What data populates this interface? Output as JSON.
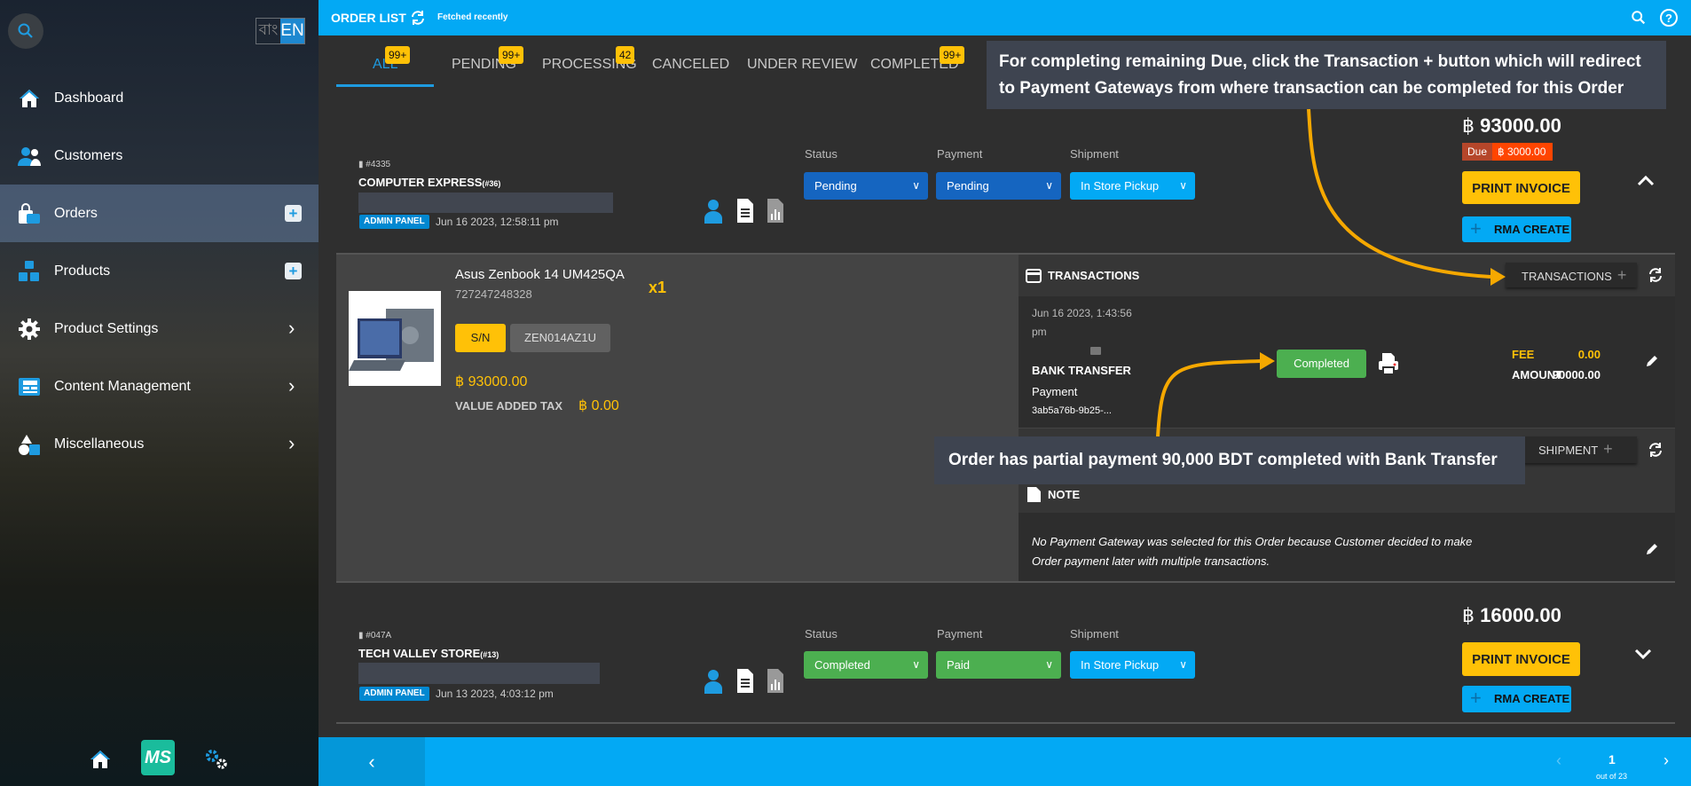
{
  "sidebar": {
    "lang": {
      "bn": "বাং",
      "en": "EN"
    },
    "items": [
      {
        "label": "Dashboard",
        "icon": "home-icon"
      },
      {
        "label": "Customers",
        "icon": "users-icon"
      },
      {
        "label": "Orders",
        "icon": "shopping-bag-icon",
        "active": true,
        "action": "plus"
      },
      {
        "label": "Products",
        "icon": "boxes-icon",
        "action": "plus"
      },
      {
        "label": "Product Settings",
        "icon": "gear-icon",
        "action": "chevron"
      },
      {
        "label": "Content Management",
        "icon": "newspaper-icon",
        "action": "chevron"
      },
      {
        "label": "Miscellaneous",
        "icon": "shapes-icon",
        "action": "chevron"
      }
    ],
    "footer": {
      "logo": "MS"
    }
  },
  "topbar": {
    "title": "ORDER LIST",
    "status": "Fetched recently"
  },
  "tabs": [
    {
      "label": "ALL",
      "badge": "99+",
      "active": true
    },
    {
      "label": "PENDING",
      "badge": "99+"
    },
    {
      "label": "PROCESSING",
      "badge": "42"
    },
    {
      "label": "CANCELED"
    },
    {
      "label": "UNDER REVIEW"
    },
    {
      "label": "COMPLETED",
      "badge": "99+"
    }
  ],
  "callouts": {
    "top": [
      "For completing remaining Due, click the Transaction + button which will redirect",
      "to Payment Gateways from where transaction can be completed for this Order"
    ],
    "middle": "Order has partial payment 90,000 BDT completed with Bank Transfer",
    "color": "#f5a800"
  },
  "labels": {
    "status": "Status",
    "payment": "Payment",
    "shipment": "Shipment",
    "print_invoice": "PRINT INVOICE",
    "rma_create": "RMA CREATE",
    "admin_panel": "ADMIN PANEL",
    "due": "Due",
    "currency_icon": "taka-sign"
  },
  "orders": [
    {
      "id": "#4335",
      "customer": "COMPUTER EXPRESS",
      "customer_no": "(#36)",
      "date": "Jun 16 2023, 12:58:11 pm",
      "status": "Pending",
      "payment": "Pending",
      "shipment": "In Store Pickup",
      "total": "93000.00",
      "due": "3000.00",
      "expanded": true,
      "item": {
        "name": "Asus Zenbook 14 UM425QA",
        "sku": "727247248328",
        "qty": "x1",
        "sn_label": "S/N",
        "serial": "ZEN014AZ1U",
        "price": "93000.00",
        "vat_label": "VALUE ADDED TAX",
        "vat": "0.00"
      },
      "transactions": {
        "title": "TRANSACTIONS",
        "button": "TRANSACTIONS",
        "entries": [
          {
            "date": "Jun 16 2023, 1:43:56",
            "date2": "pm",
            "method": "BANK TRANSFER",
            "type": "Payment",
            "ref": "3ab5a76b-9b25-...",
            "status": "Completed",
            "fee_label": "FEE",
            "fee": "0.00",
            "amount_label": "AMOUNT",
            "amount": "90000.00"
          }
        ]
      },
      "shipment_button": "SHIPMENT",
      "note": {
        "title": "NOTE",
        "lines": [
          "No Payment Gateway was selected for this Order because Customer decided to make",
          "Order payment later with multiple transactions."
        ]
      }
    },
    {
      "id": "#047A",
      "customer": "TECH VALLEY STORE",
      "customer_no": "(#13)",
      "date": "Jun 13 2023, 4:03:12 pm",
      "status": "Completed",
      "payment": "Paid",
      "shipment": "In Store Pickup",
      "total": "16000.00",
      "expanded": false
    }
  ],
  "pagination": {
    "page": "1",
    "total_text": "out of 23"
  },
  "colors": {
    "accent": "#03a9f4",
    "pending": "#1565c0",
    "completed": "#4caf50",
    "warning": "#ffc107",
    "due": "#ff4500"
  }
}
